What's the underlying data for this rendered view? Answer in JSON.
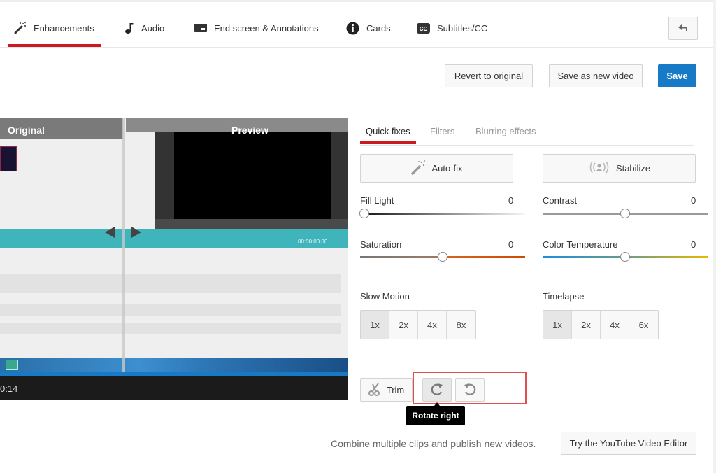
{
  "tabs": [
    {
      "label": "Enhancements",
      "icon": "magic-wand-icon",
      "active": true
    },
    {
      "label": "Audio",
      "icon": "music-note-icon",
      "active": false
    },
    {
      "label": "End screen & Annotations",
      "icon": "end-screen-icon",
      "active": false
    },
    {
      "label": "Cards",
      "icon": "info-icon",
      "active": false
    },
    {
      "label": "Subtitles/CC",
      "icon": "cc-icon",
      "active": false
    }
  ],
  "back_button": {
    "icon": "back-arrow-icon"
  },
  "actions": {
    "revert": "Revert to original",
    "save_new": "Save as new video",
    "save": "Save"
  },
  "video": {
    "label_original": "Original",
    "label_preview": "Preview",
    "inner_timecode": "00:00:00.00",
    "current_time": "0:14"
  },
  "subtabs": [
    {
      "label": "Quick fixes",
      "active": true
    },
    {
      "label": "Filters",
      "active": false
    },
    {
      "label": "Blurring effects",
      "active": false
    }
  ],
  "quick_fixes": {
    "autofix": "Auto-fix",
    "stabilize": "Stabilize",
    "sliders": [
      {
        "label": "Fill Light",
        "value": "0",
        "position": 0.0
      },
      {
        "label": "Contrast",
        "value": "0",
        "position": 0.5
      },
      {
        "label": "Saturation",
        "value": "0",
        "position": 0.5
      },
      {
        "label": "Color Temperature",
        "value": "0",
        "position": 0.5
      }
    ],
    "slow_motion": {
      "label": "Slow Motion",
      "options": [
        "1x",
        "2x",
        "4x",
        "8x"
      ],
      "selected": "1x"
    },
    "timelapse": {
      "label": "Timelapse",
      "options": [
        "1x",
        "2x",
        "4x",
        "6x"
      ],
      "selected": "1x"
    },
    "trim": "Trim",
    "rotate_tooltip": "Rotate right"
  },
  "footer": {
    "text": "Combine multiple clips and publish new videos.",
    "button": "Try the YouTube Video Editor"
  },
  "colors": {
    "accent_red": "#cc181e",
    "primary_blue": "#167ac6",
    "highlight_box": "#e05050"
  }
}
